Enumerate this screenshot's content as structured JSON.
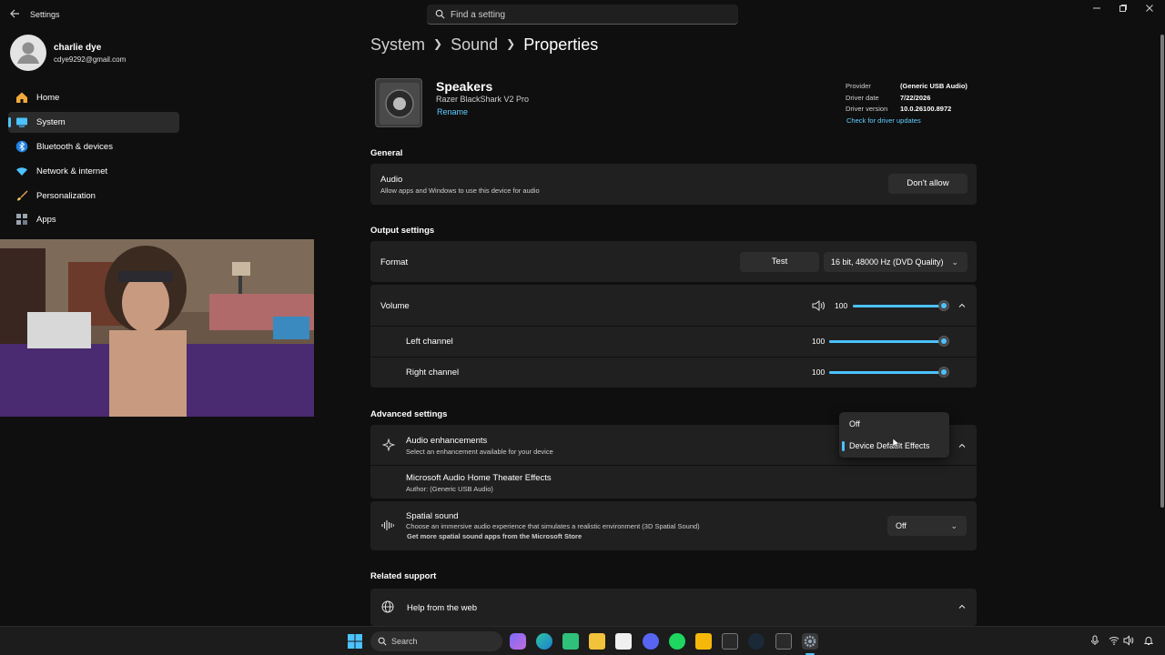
{
  "window": {
    "title": "Settings",
    "search_placeholder": "Find a setting"
  },
  "user": {
    "name": "charlie dye",
    "email": "cdye9292@gmail.com"
  },
  "sidebar": {
    "items": [
      {
        "label": "Home",
        "icon": "home-icon"
      },
      {
        "label": "System",
        "icon": "system-icon",
        "active": true
      },
      {
        "label": "Bluetooth & devices",
        "icon": "bluetooth-icon"
      },
      {
        "label": "Network & internet",
        "icon": "network-icon"
      },
      {
        "label": "Personalization",
        "icon": "brush-icon"
      },
      {
        "label": "Apps",
        "icon": "apps-icon"
      }
    ]
  },
  "breadcrumb": [
    "System",
    "Sound",
    "Properties"
  ],
  "device": {
    "name": "Speakers",
    "model": "Razer BlackShark V2 Pro",
    "rename": "Rename",
    "driver": {
      "provider_label": "Provider",
      "provider": "(Generic USB Audio)",
      "date_label": "Driver date",
      "date": "7/22/2026",
      "version_label": "Driver version",
      "version": "10.0.26100.8972",
      "update_link": "Check for driver updates"
    }
  },
  "general": {
    "title": "General",
    "audio_title": "Audio",
    "audio_desc": "Allow apps and Windows to use this device for audio",
    "audio_button": "Don't allow"
  },
  "output": {
    "title": "Output settings",
    "format_label": "Format",
    "test_button": "Test",
    "format_value": "16 bit, 48000 Hz (DVD Quality)",
    "volume_label": "Volume",
    "volume_value": "100",
    "left_label": "Left channel",
    "left_value": "100",
    "right_label": "Right channel",
    "right_value": "100"
  },
  "advanced": {
    "title": "Advanced settings",
    "enh_title": "Audio enhancements",
    "enh_desc": "Select an enhancement available for your device",
    "enh_options": [
      "Off",
      "Device Default Effects"
    ],
    "enh_selected": "Device Default Effects",
    "ms_title": "Microsoft Audio Home Theater Effects",
    "ms_author": "Author: (Generic USB Audio)",
    "spatial_title": "Spatial sound",
    "spatial_desc": "Choose an immersive audio experience that simulates a realistic environment (3D Spatial Sound)",
    "spatial_link": "Get more spatial sound apps from the Microsoft Store",
    "spatial_value": "Off"
  },
  "related": {
    "title": "Related support",
    "help_title": "Help from the web"
  },
  "taskbar": {
    "search_label": "Search",
    "apps": [
      "start-icon",
      "copilot-icon",
      "edge-icon",
      "store-icon",
      "file-explorer-icon",
      "ms-store-icon",
      "discord-icon",
      "spotify-icon",
      "rockstar-icon",
      "epic-games-icon",
      "steam-icon",
      "epic-icon",
      "settings-icon"
    ]
  },
  "colors": {
    "accent": "#4cc2ff",
    "background": "#0f0f0f",
    "card": "#202020"
  }
}
